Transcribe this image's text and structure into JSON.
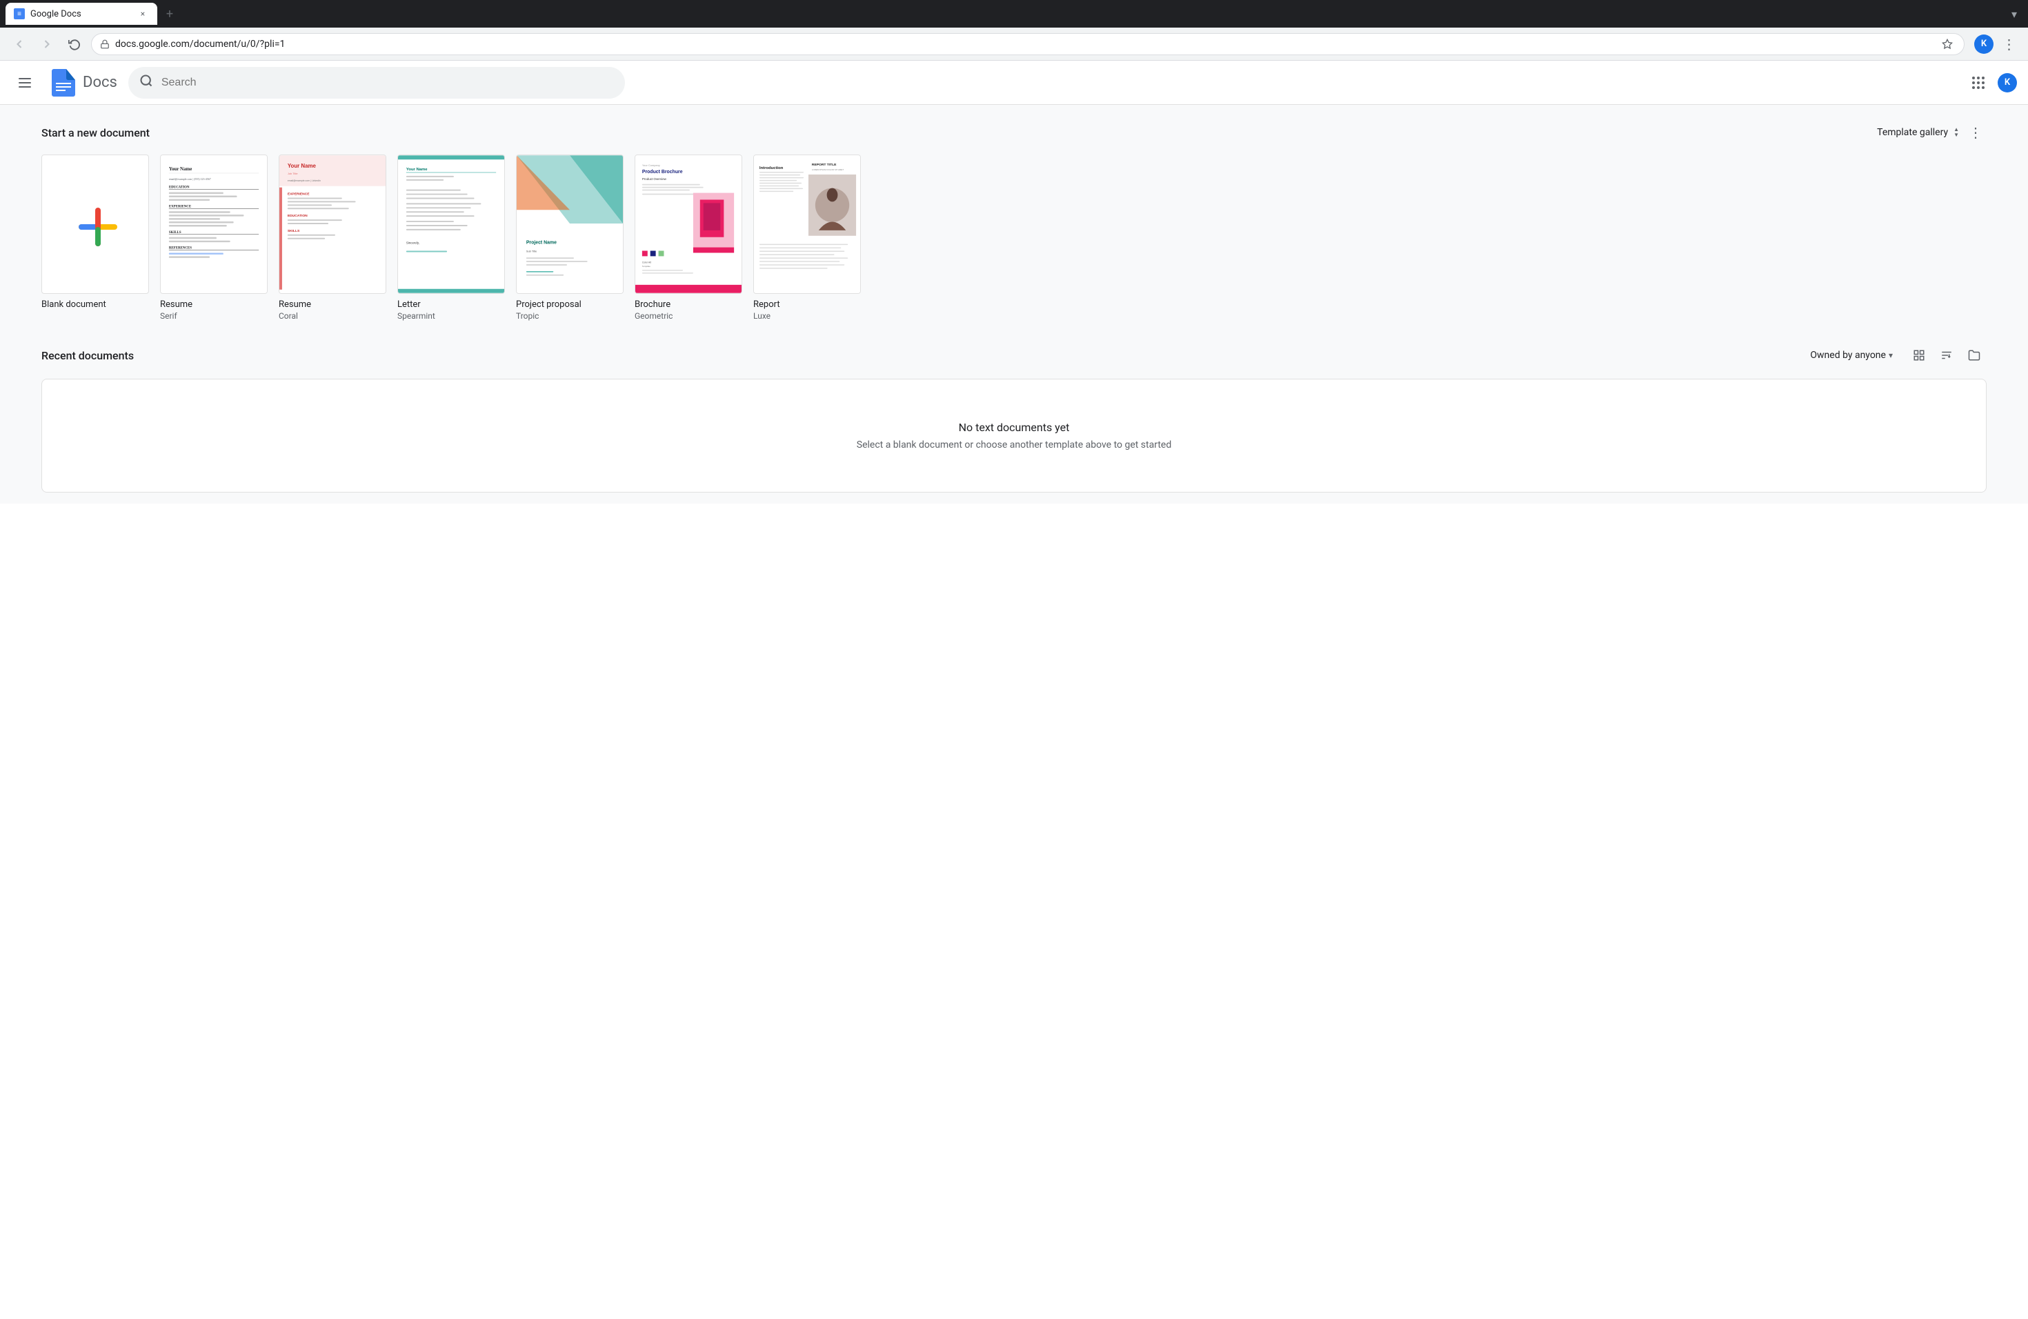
{
  "browser": {
    "tab_title": "Google Docs",
    "tab_favicon": "docs",
    "close_btn": "×",
    "new_tab_btn": "+",
    "address": "docs.google.com/document/u/0/?pli=1",
    "back_btn": "‹",
    "forward_btn": "›",
    "refresh_btn": "↻",
    "star_btn": "☆",
    "user_initial": "K",
    "menu_btn": "⋮",
    "window_collapse": "▾"
  },
  "appbar": {
    "logo_text": "Docs",
    "search_placeholder": "Search",
    "user_initial": "K"
  },
  "templates": {
    "section_title": "Start a new document",
    "gallery_btn": "Template gallery",
    "items": [
      {
        "name": "Blank document",
        "subname": "",
        "type": "blank"
      },
      {
        "name": "Resume",
        "subname": "Serif",
        "type": "resume-serif"
      },
      {
        "name": "Resume",
        "subname": "Coral",
        "type": "resume-coral"
      },
      {
        "name": "Letter",
        "subname": "Spearmint",
        "type": "letter-spearmint"
      },
      {
        "name": "Project proposal",
        "subname": "Tropic",
        "type": "project-tropic"
      },
      {
        "name": "Brochure",
        "subname": "Geometric",
        "type": "brochure-geometric"
      },
      {
        "name": "Report",
        "subname": "Luxe",
        "type": "report-luxe"
      }
    ]
  },
  "recent": {
    "section_title": "Recent documents",
    "owned_by": "Owned by anyone",
    "no_docs_title": "No text documents yet",
    "no_docs_sub": "Select a blank document or choose another template above to get started"
  }
}
